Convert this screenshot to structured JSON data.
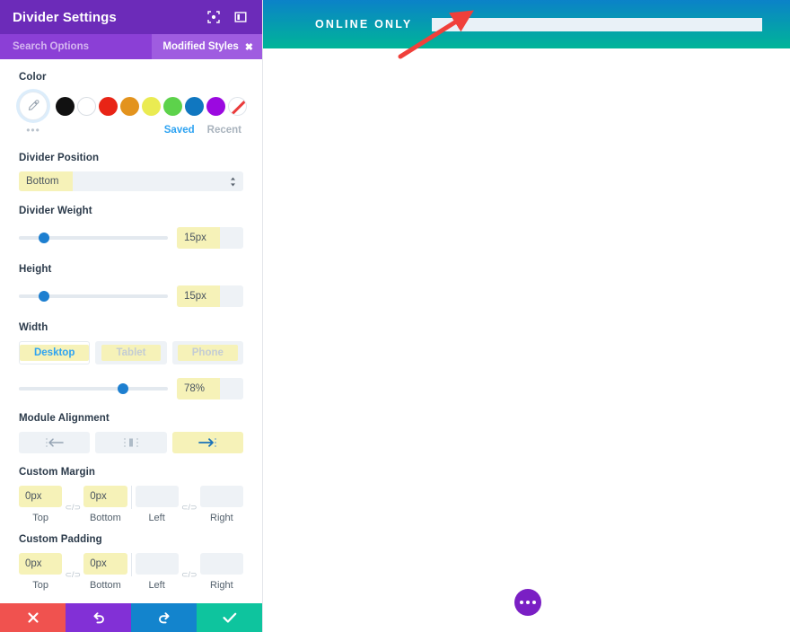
{
  "panel": {
    "title": "Divider Settings",
    "header_icons": [
      {
        "name": "fullscreen-icon",
        "label": "expand"
      },
      {
        "name": "layout-panel-icon",
        "label": "panel layout"
      }
    ],
    "search": {
      "placeholder": "Search Options",
      "value": ""
    },
    "modified_badge": {
      "label": "Modified Styles",
      "close": "✖"
    },
    "fields": {
      "color": {
        "label": "Color",
        "eyedropper_icon": "eyedropper-icon",
        "more_dots": "•••",
        "swatches": [
          {
            "name": "swatch-black",
            "hex": "#111111"
          },
          {
            "name": "swatch-white",
            "hex": "#ffffff"
          },
          {
            "name": "swatch-red",
            "hex": "#e82416"
          },
          {
            "name": "swatch-orange",
            "hex": "#e3931d"
          },
          {
            "name": "swatch-yellow",
            "hex": "#eaeb52"
          },
          {
            "name": "swatch-green",
            "hex": "#5dd24b"
          },
          {
            "name": "swatch-blue",
            "hex": "#1077c0"
          },
          {
            "name": "swatch-purple",
            "hex": "#9b09e0"
          }
        ],
        "none_swatch": "swatch-transparent",
        "tabs": [
          {
            "label": "Saved",
            "active": true
          },
          {
            "label": "Recent",
            "active": false
          }
        ]
      },
      "divider_position": {
        "label": "Divider Position",
        "value": "Bottom"
      },
      "divider_weight": {
        "label": "Divider Weight",
        "value": "15px",
        "slider_percent": 17
      },
      "height": {
        "label": "Height",
        "value": "15px",
        "slider_percent": 17
      },
      "width": {
        "label": "Width",
        "devices": [
          {
            "label": "Desktop",
            "active": true
          },
          {
            "label": "Tablet",
            "active": false
          },
          {
            "label": "Phone",
            "active": false
          }
        ],
        "value": "78%",
        "slider_percent": 70
      },
      "module_alignment": {
        "label": "Module Alignment",
        "options": [
          {
            "name": "align-left-icon",
            "active": false
          },
          {
            "name": "align-center-icon",
            "active": false
          },
          {
            "name": "align-right-icon",
            "active": true
          }
        ]
      },
      "custom_margin": {
        "label": "Custom Margin",
        "top": {
          "caption": "Top",
          "value": "0px",
          "filled": true
        },
        "bottom": {
          "caption": "Bottom",
          "value": "0px",
          "filled": true
        },
        "left": {
          "caption": "Left",
          "value": "",
          "filled": false
        },
        "right": {
          "caption": "Right",
          "value": "",
          "filled": false
        },
        "link_icon": "⊂/⊃"
      },
      "custom_padding": {
        "label": "Custom Padding",
        "top": {
          "caption": "Top",
          "value": "0px",
          "filled": true
        },
        "bottom": {
          "caption": "Bottom",
          "value": "0px",
          "filled": true
        },
        "left": {
          "caption": "Left",
          "value": "",
          "filled": false
        },
        "right": {
          "caption": "Right",
          "value": "",
          "filled": false
        },
        "link_icon": "⊂/⊃"
      }
    },
    "footer": [
      {
        "name": "cancel-button",
        "icon": "close-icon",
        "color": "#f0524f"
      },
      {
        "name": "undo-button",
        "icon": "undo-icon",
        "color": "#8230d6"
      },
      {
        "name": "redo-button",
        "icon": "redo-icon",
        "color": "#1384cd"
      },
      {
        "name": "save-button",
        "icon": "check-icon",
        "color": "#0ec49e"
      }
    ]
  },
  "preview": {
    "banner": {
      "text": "ONLINE ONLY",
      "gradient_from": "#0b82c8",
      "gradient_to": "#00b598",
      "divider_color": "#e9f1f7"
    },
    "annotation_arrow": {
      "name": "red-arrow-annotation",
      "color": "#f0403a"
    },
    "fab": {
      "name": "more-options-fab",
      "color": "#7a1fc4",
      "dots": 3
    }
  }
}
